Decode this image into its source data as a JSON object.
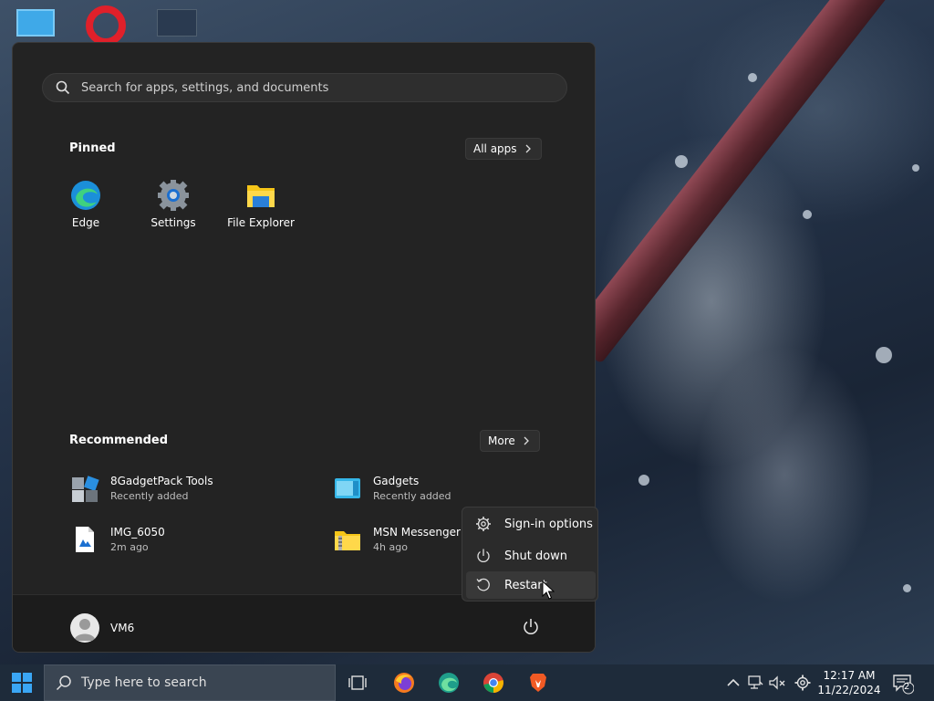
{
  "start_menu": {
    "search": {
      "placeholder": "Search for apps, settings, and documents"
    },
    "pinned": {
      "title": "Pinned",
      "all_apps_label": "All apps",
      "apps": [
        {
          "label": "Edge",
          "icon": "edge-icon"
        },
        {
          "label": "Settings",
          "icon": "settings-gear-icon"
        },
        {
          "label": "File Explorer",
          "icon": "folder-icon"
        }
      ]
    },
    "recommended": {
      "title": "Recommended",
      "more_label": "More",
      "items": [
        {
          "name": "8GadgetPack Tools",
          "sub": "Recently added",
          "icon": "gadgetpack-icon"
        },
        {
          "name": "Gadgets",
          "sub": "Recently added",
          "icon": "gadgets-icon"
        },
        {
          "name": "IMG_6050",
          "sub": "2m ago",
          "icon": "image-file-icon"
        },
        {
          "name": "MSN Messenger",
          "sub": "4h ago",
          "icon": "zip-folder-icon"
        }
      ]
    },
    "user": {
      "name": "VM6"
    }
  },
  "power_menu": {
    "items": [
      {
        "label": "Sign-in options",
        "icon": "gear-icon"
      },
      {
        "label": "Shut down",
        "icon": "power-icon"
      },
      {
        "label": "Restart",
        "icon": "restart-icon"
      }
    ]
  },
  "taskbar": {
    "search_placeholder": "Type here to search",
    "apps": [
      "task-view-icon",
      "firefox-icon",
      "edge-icon",
      "chrome-icon",
      "brave-icon"
    ],
    "tray": {
      "time": "12:17 AM",
      "date": "11/22/2024",
      "notification_count": "2"
    }
  }
}
